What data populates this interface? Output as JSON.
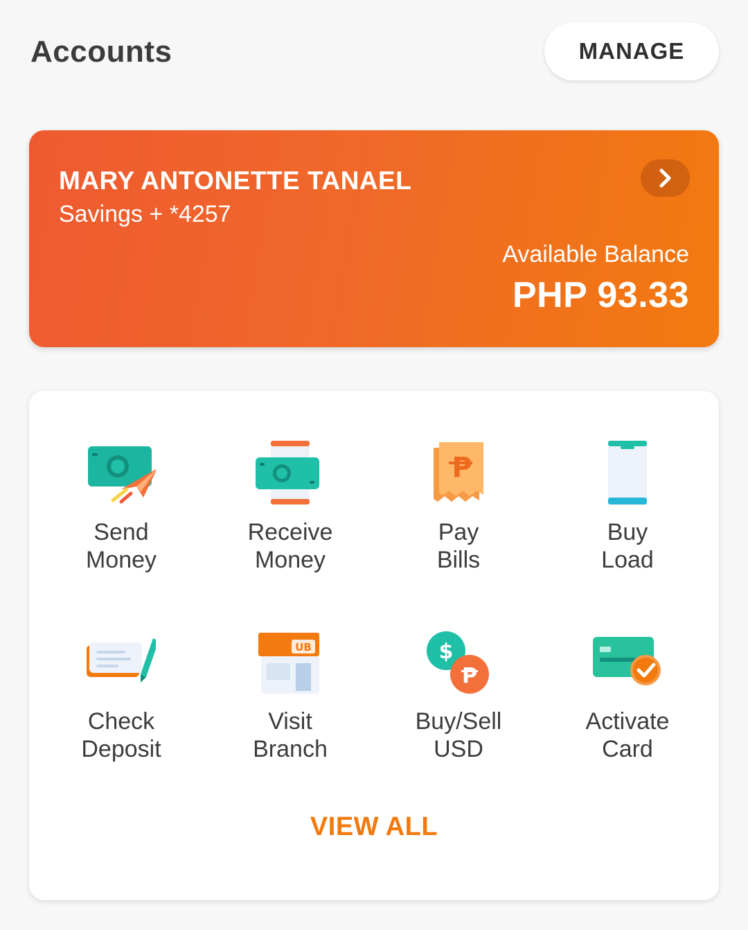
{
  "header": {
    "title": "Accounts",
    "manage_label": "MANAGE"
  },
  "account": {
    "name": "MARY ANTONETTE TANAEL",
    "type": "Savings + *4257",
    "balance_label": "Available Balance",
    "balance_value": "PHP 93.33",
    "gradient_start": "#ee5a30",
    "gradient_end": "#f27a0e"
  },
  "actions": [
    {
      "label": "Send\nMoney",
      "icon": "send-money-icon"
    },
    {
      "label": "Receive\nMoney",
      "icon": "receive-money-icon"
    },
    {
      "label": "Pay\nBills",
      "icon": "pay-bills-icon"
    },
    {
      "label": "Buy\nLoad",
      "icon": "buy-load-icon"
    },
    {
      "label": "Check\nDeposit",
      "icon": "check-deposit-icon"
    },
    {
      "label": "Visit\nBranch",
      "icon": "visit-branch-icon"
    },
    {
      "label": "Buy/Sell\nUSD",
      "icon": "buy-sell-usd-icon"
    },
    {
      "label": "Activate\nCard",
      "icon": "activate-card-icon"
    }
  ],
  "view_all_label": "VIEW ALL",
  "colors": {
    "accent": "#f27a0e",
    "teal": "#1fbfa8",
    "text": "#3c3c3c"
  }
}
